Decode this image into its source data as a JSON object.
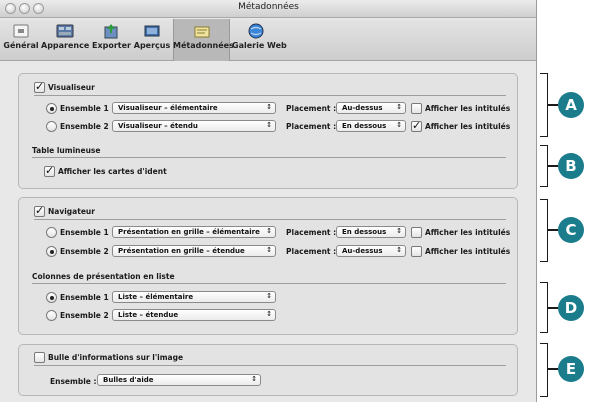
{
  "window": {
    "title": "Métadonnées"
  },
  "toolbar": {
    "items": [
      {
        "label": "Général",
        "icon": "general-icon"
      },
      {
        "label": "Apparence",
        "icon": "appearance-icon"
      },
      {
        "label": "Exporter",
        "icon": "export-icon"
      },
      {
        "label": "Aperçus",
        "icon": "previews-icon"
      },
      {
        "label": "Métadonnées",
        "icon": "metadata-icon",
        "selected": true
      },
      {
        "label": "Galerie Web",
        "icon": "web-gallery-icon"
      }
    ]
  },
  "viewer": {
    "checkbox_label": "Visualiseur",
    "set1": {
      "label": "Ensemble 1 :",
      "value": "Visualiseur – élémentaire",
      "placement_label": "Placement :",
      "placement": "Au-dessus",
      "show_labels": "Afficher les intitulés",
      "show_checked": false,
      "selected": true
    },
    "set2": {
      "label": "Ensemble 2 :",
      "value": "Visualiseur – étendu",
      "placement_label": "Placement :",
      "placement": "En dessous",
      "show_labels": "Afficher les intitulés",
      "show_checked": true,
      "selected": false
    },
    "lighttable_title": "Table lumineuse",
    "show_cards": "Afficher les cartes d'ident"
  },
  "browser": {
    "checkbox_label": "Navigateur",
    "set1": {
      "label": "Ensemble 1 :",
      "value": "Présentation en grille – élémentaire",
      "placement_label": "Placement :",
      "placement": "En dessous",
      "show_labels": "Afficher les intitulés",
      "show_checked": false,
      "selected": false
    },
    "set2": {
      "label": "Ensemble 2 :",
      "value": "Présentation en grille – étendue",
      "placement_label": "Placement :",
      "placement": "Au-dessus",
      "show_labels": "Afficher les intitulés",
      "show_checked": false,
      "selected": true
    },
    "list_title": "Colonnes de présentation en liste",
    "list_set1": {
      "label": "Ensemble 1 :",
      "value": "Liste – élémentaire",
      "selected": true
    },
    "list_set2": {
      "label": "Ensemble 2 :",
      "value": "Liste – étendue",
      "selected": false
    }
  },
  "tooltip": {
    "checkbox_label": "Bulle d'informations sur l'image",
    "set_label": "Ensemble :",
    "set_value": "Bulles d'aide"
  },
  "callouts": [
    "A",
    "B",
    "C",
    "D",
    "E"
  ],
  "colors": {
    "badge": "#1b7c8c"
  }
}
